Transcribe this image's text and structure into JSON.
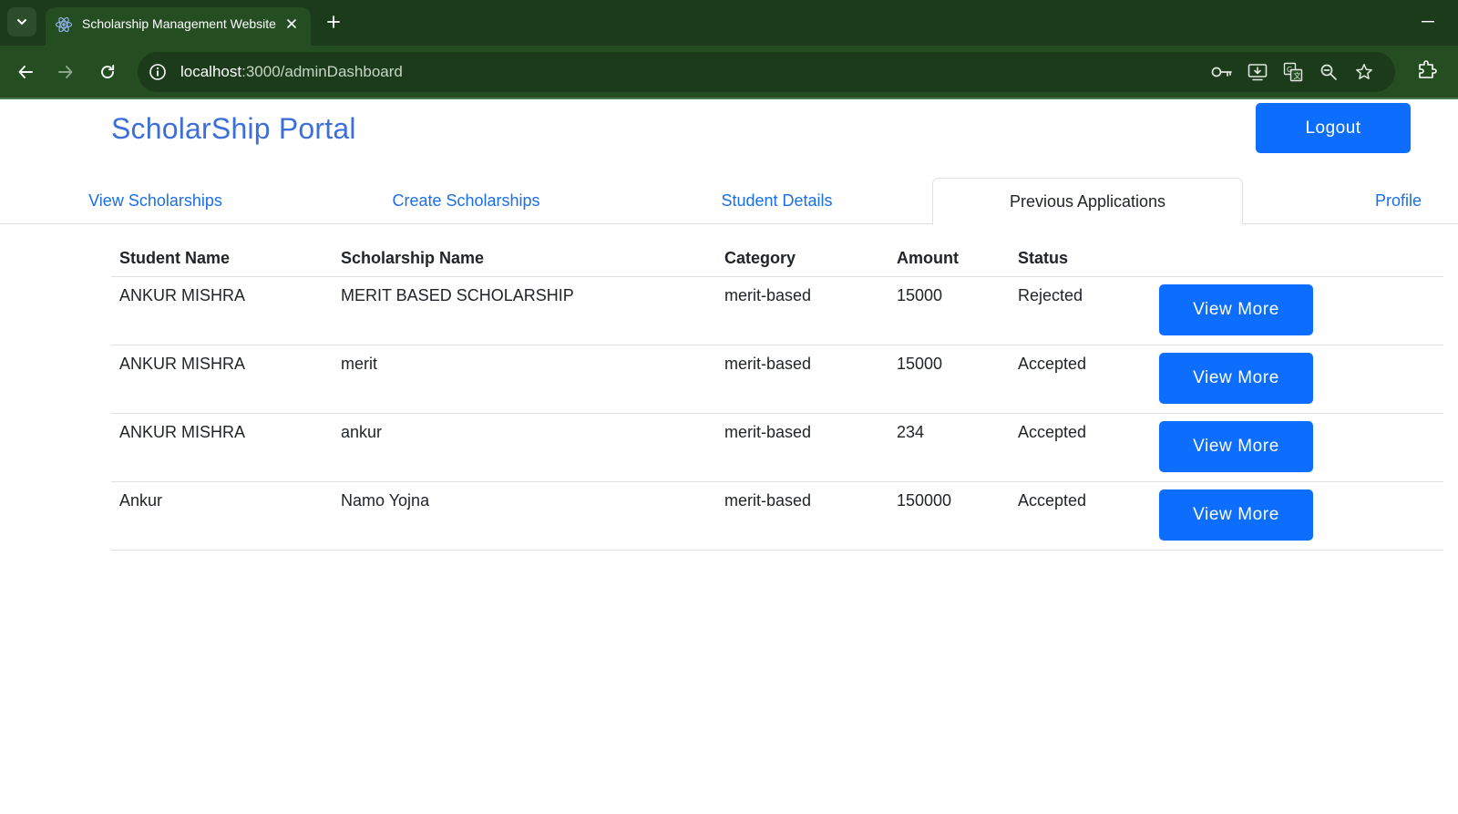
{
  "browser": {
    "tab_title": "Scholarship Management Website",
    "url_host": "localhost",
    "url_path": ":3000/adminDashboard"
  },
  "header": {
    "brand": "ScholarShip Portal",
    "logout_label": "Logout"
  },
  "tabs": [
    {
      "label": "View Scholarships",
      "active": false
    },
    {
      "label": "Create Scholarships",
      "active": false
    },
    {
      "label": "Student Details",
      "active": false
    },
    {
      "label": "Previous Applications",
      "active": true
    },
    {
      "label": "Profile",
      "active": false
    }
  ],
  "table": {
    "headers": [
      "Student Name",
      "Scholarship Name",
      "Category",
      "Amount",
      "Status"
    ],
    "rows": [
      {
        "student": "ANKUR MISHRA",
        "scholarship": "MERIT BASED SCHOLARSHIP",
        "category": "merit-based",
        "amount": "15000",
        "status": "Rejected",
        "action": "View More"
      },
      {
        "student": "ANKUR MISHRA",
        "scholarship": "merit",
        "category": "merit-based",
        "amount": "15000",
        "status": "Accepted",
        "action": "View More"
      },
      {
        "student": "ANKUR MISHRA",
        "scholarship": "ankur",
        "category": "merit-based",
        "amount": "234",
        "status": "Accepted",
        "action": "View More"
      },
      {
        "student": "Ankur",
        "scholarship": "Namo Yojna",
        "category": "merit-based",
        "amount": "150000",
        "status": "Accepted",
        "action": "View More"
      }
    ]
  },
  "colors": {
    "brand": "#3d6fd9",
    "primary_button": "#0d6efd",
    "chrome_dark": "#1b3b1a",
    "chrome_toolbar": "#244d22"
  }
}
